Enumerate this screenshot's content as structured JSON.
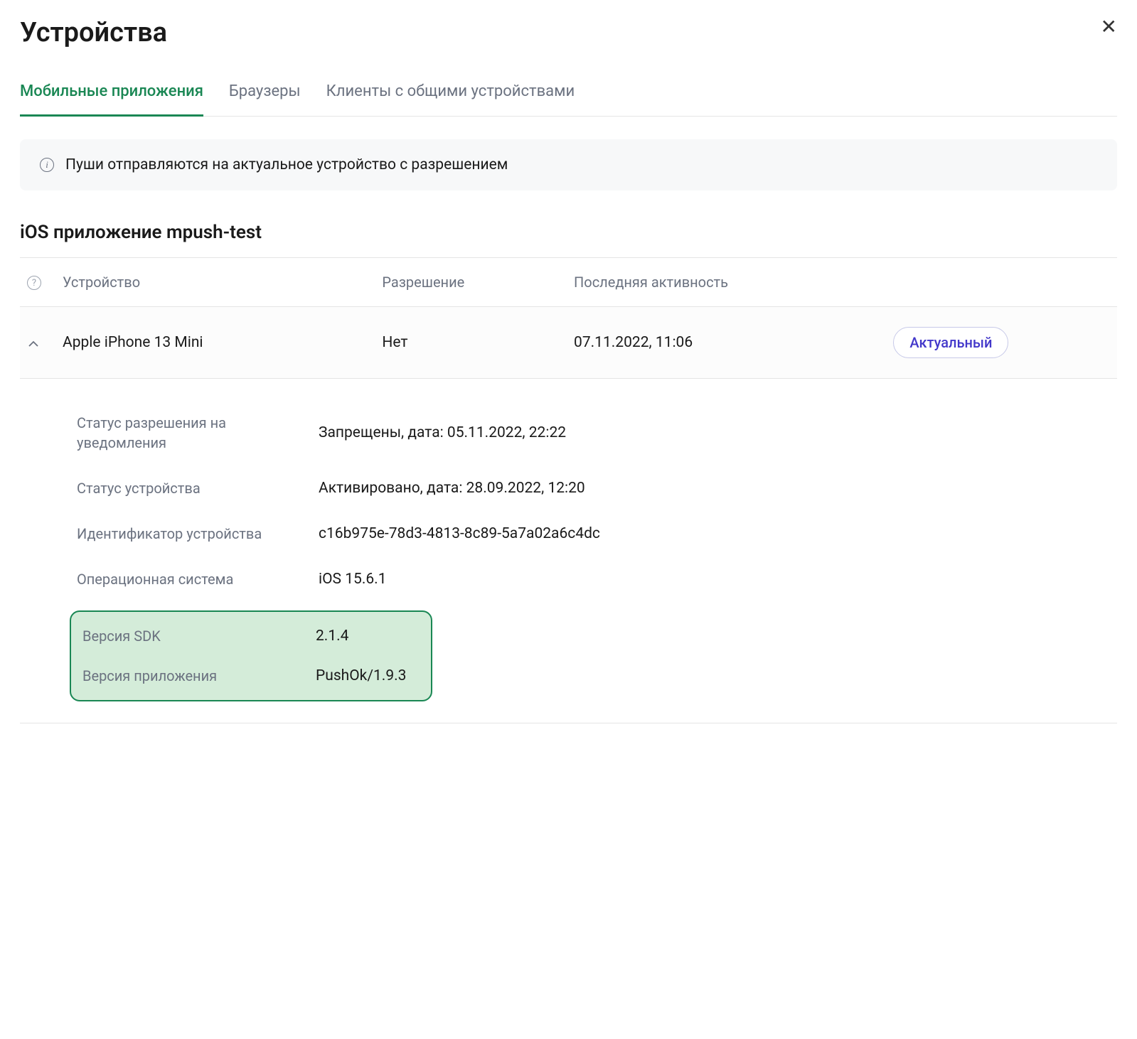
{
  "dialog": {
    "title": "Устройства"
  },
  "tabs": [
    {
      "label": "Мобильные приложения",
      "active": true
    },
    {
      "label": "Браузеры",
      "active": false
    },
    {
      "label": "Клиенты с общими устройствами",
      "active": false
    }
  ],
  "banner": {
    "text": "Пуши отправляются на актуальное устройство с разрешением"
  },
  "section": {
    "title": "iOS приложение mpush-test"
  },
  "table": {
    "headers": {
      "device": "Устройство",
      "permission": "Разрешение",
      "last_activity": "Последняя активность"
    },
    "row": {
      "device": "Apple iPhone 13 Mini",
      "permission": "Нет",
      "last_activity": "07.11.2022, 11:06",
      "status_badge": "Актуальный"
    }
  },
  "details": {
    "permission_status": {
      "label": "Статус разрешения на уведомления",
      "value": "Запрещены, дата: 05.11.2022, 22:22"
    },
    "device_status": {
      "label": "Статус устройства",
      "value": "Активировано, дата: 28.09.2022, 12:20"
    },
    "device_id": {
      "label": "Идентификатор устройства",
      "value": "c16b975e-78d3-4813-8c89-5a7a02a6c4dc"
    },
    "os": {
      "label": "Операционная система",
      "value": "iOS 15.6.1"
    },
    "sdk_version": {
      "label": "Версия SDK",
      "value": "2.1.4"
    },
    "app_version": {
      "label": "Версия приложения",
      "value": "PushOk/1.9.3"
    }
  }
}
